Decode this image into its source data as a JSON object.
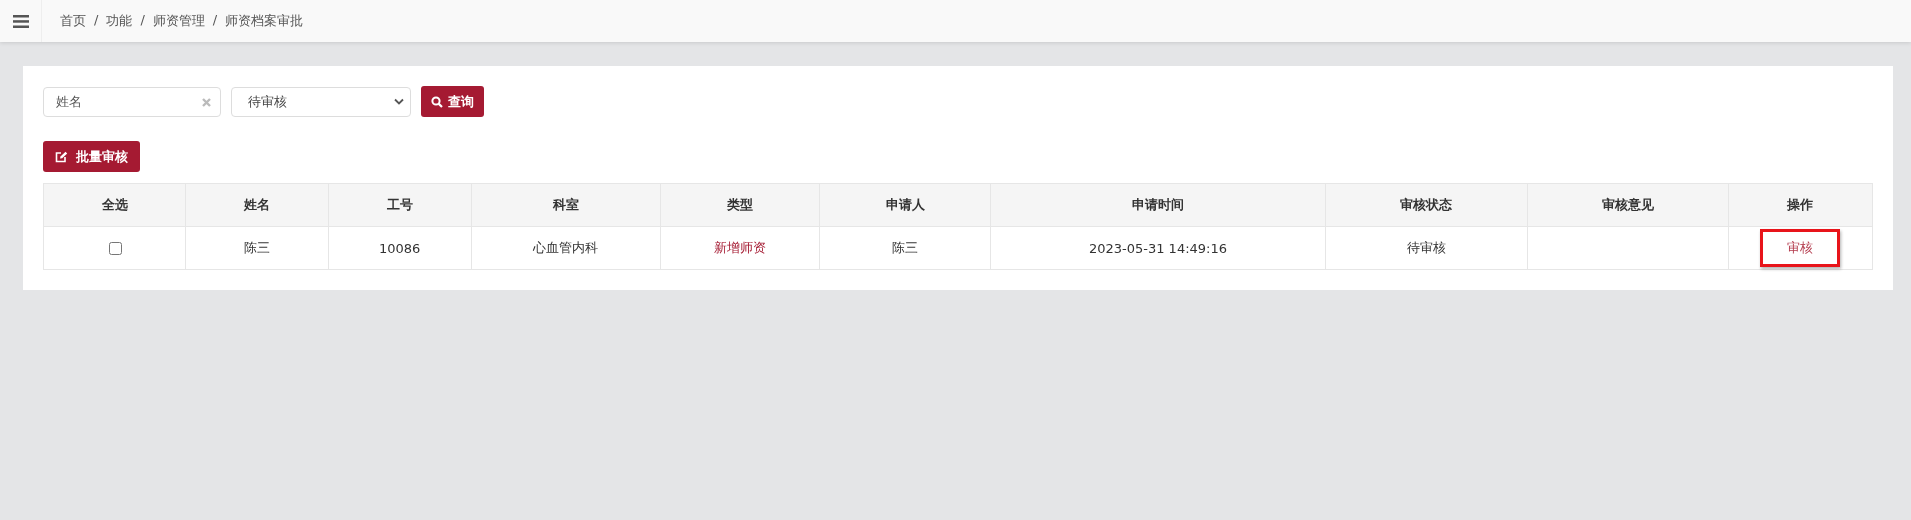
{
  "breadcrumb": [
    "首页",
    "功能",
    "师资管理",
    "师资档案审批"
  ],
  "breadcrumb_separator": "/",
  "filters": {
    "name": {
      "placeholder": "姓名"
    },
    "status": {
      "value": "待审核"
    },
    "search_button": "查询"
  },
  "batch_button": "批量审核",
  "table": {
    "columns": [
      "全选",
      "姓名",
      "工号",
      "科室",
      "类型",
      "申请人",
      "申请时间",
      "审核状态",
      "审核意见",
      "操作"
    ],
    "rows": [
      {
        "checked": false,
        "name": "陈三",
        "id": "10086",
        "dept": "心血管内科",
        "type": "新增师资",
        "applicant": "陈三",
        "time": "2023-05-31 14:49:16",
        "status": "待审核",
        "action": "审核",
        "action_highlighted": true
      }
    ]
  }
}
